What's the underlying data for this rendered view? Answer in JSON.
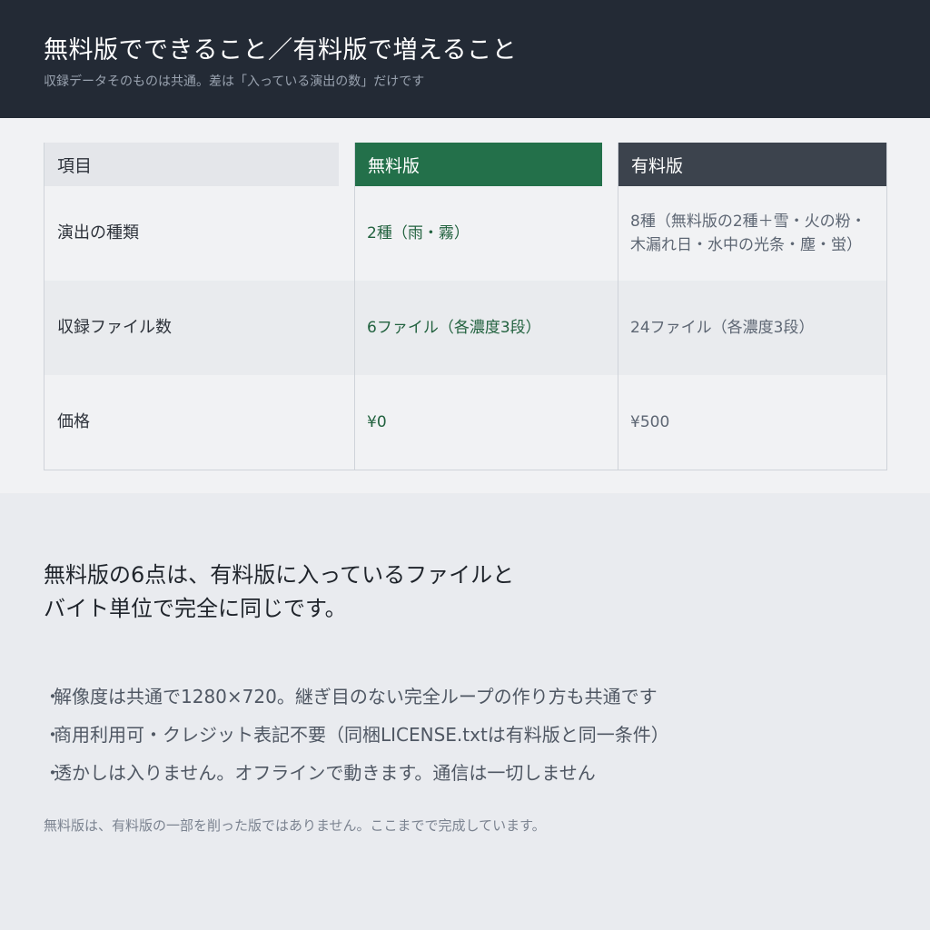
{
  "header": {
    "title": "無料版でできること／有料版で増えること",
    "subtitle": "収録データそのものは共通。差は「入っている演出の数」だけです"
  },
  "table": {
    "headers": {
      "item": "項目",
      "free": "無料版",
      "paid": "有料版"
    },
    "rows": [
      {
        "label": "演出の種類",
        "free": "2種（雨・霧）",
        "paid_line1": "8種（無料版の2種＋雪・火の粉・",
        "paid_line2": "木漏れ日・水中の光条・塵・蛍）"
      },
      {
        "label": "収録ファイル数",
        "free": "6ファイル（各濃度3段）",
        "paid_line1": "24ファイル（各濃度3段）"
      },
      {
        "label": "価格",
        "free": "¥0",
        "paid_line1": "¥500"
      }
    ]
  },
  "lead": {
    "line1": "無料版の6点は、有料版に入っているファイルと",
    "line2": "バイト単位で完全に同じです。"
  },
  "bullets": [
    "解像度は共通で1280×720。継ぎ目のない完全ループの作り方も共通です",
    "商用利用可・クレジット表記不要（同梱LICENSE.txtは有料版と同一条件）",
    "透かしは入りません。オフラインで動きます。通信は一切しません"
  ],
  "bullet_mark": "・",
  "note": "無料版は、有料版の一部を削った版ではありません。ここまでで完成しています。"
}
